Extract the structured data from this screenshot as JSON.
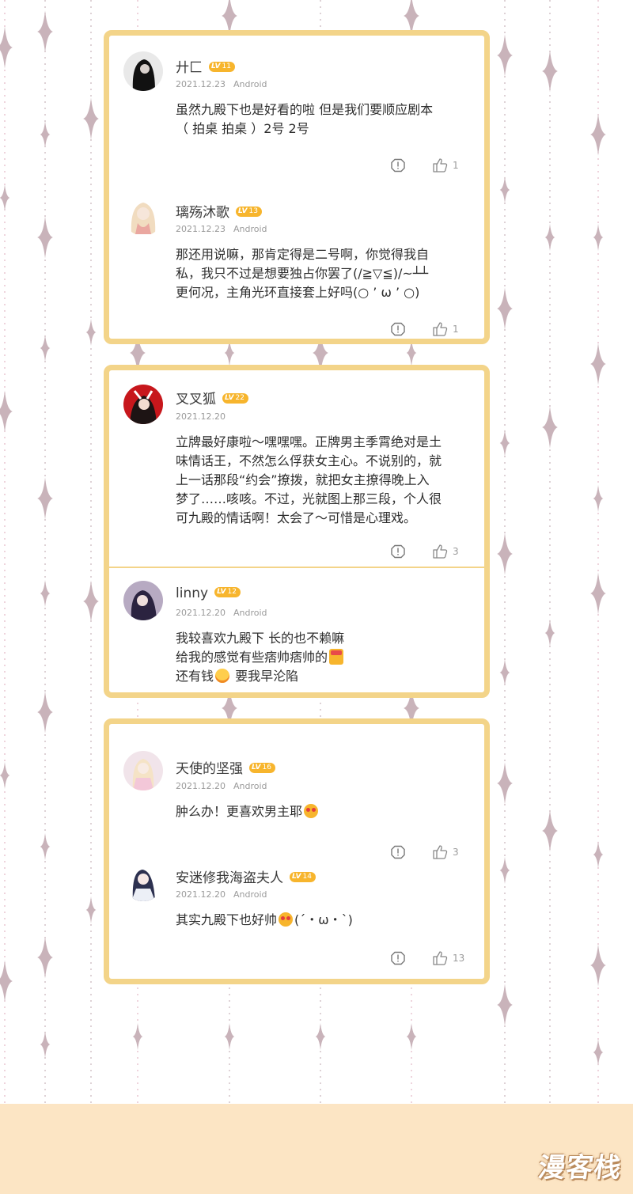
{
  "colors": {
    "card_border": "#f3d489",
    "level_badge": "#f7b52d",
    "footer": "#fce5c4",
    "sparkle": "#c9b3ba"
  },
  "level_prefix": "LV",
  "cards": [
    {
      "comments": [
        {
          "user": "廾匚",
          "level": "11",
          "date": "2021.12.23",
          "device": "Android",
          "lines": [
            "虽然九殿下也是好看的啦 但是我们要顺应剧本",
            "（ 拍桌 拍桌 ）2号 2号"
          ],
          "likes": "1"
        },
        {
          "user": "璃殇沐歌",
          "level": "13",
          "date": "2021.12.23",
          "device": "Android",
          "lines": [
            "那还用说嘛，那肯定得是二号啊，你觉得我自",
            "私，我只不过是想要独占你罢了(/≧▽≦)/~┴┴",
            "更何况，主角光环直接套上好吗(○ ’ ω ’ ○)"
          ],
          "likes": "1"
        }
      ]
    },
    {
      "comments": [
        {
          "user": "叉叉狐",
          "level": "22",
          "date": "2021.12.20",
          "device": "",
          "lines": [
            "立牌最好康啦～嘿嘿嘿。正牌男主季霄绝对是土",
            "味情话王，不然怎么俘获女主心。不说别的，就",
            "上一话那段“约会”撩拨，就把女主撩得晚上入",
            "梦了……咳咳。不过，光就图上那三段，个人很",
            "可九殿的情话啊！太会了～可惜是心理戏。"
          ],
          "likes": "3"
        },
        {
          "user": "linny",
          "level": "12",
          "date": "2021.12.20",
          "device": "Android",
          "lines": [
            "我较喜欢九殿下 长的也不赖嘛",
            "给我的感觉有些痞帅痞帅的",
            "还有钱",
            "要我早沦陷"
          ]
        }
      ]
    },
    {
      "comments": [
        {
          "user": "天使的坚强",
          "level": "16",
          "date": "2021.12.20",
          "device": "Android",
          "lines": [
            "肿么办！更喜欢男主耶"
          ],
          "likes": "3"
        },
        {
          "user": "安迷修我海盗夫人",
          "level": "14",
          "date": "2021.12.20",
          "device": "Android",
          "lines": [
            "其实九殿下也好帅",
            "(´・ω・`)"
          ],
          "likes": "13"
        }
      ]
    }
  ],
  "footer": {
    "logo": "漫客栈"
  }
}
